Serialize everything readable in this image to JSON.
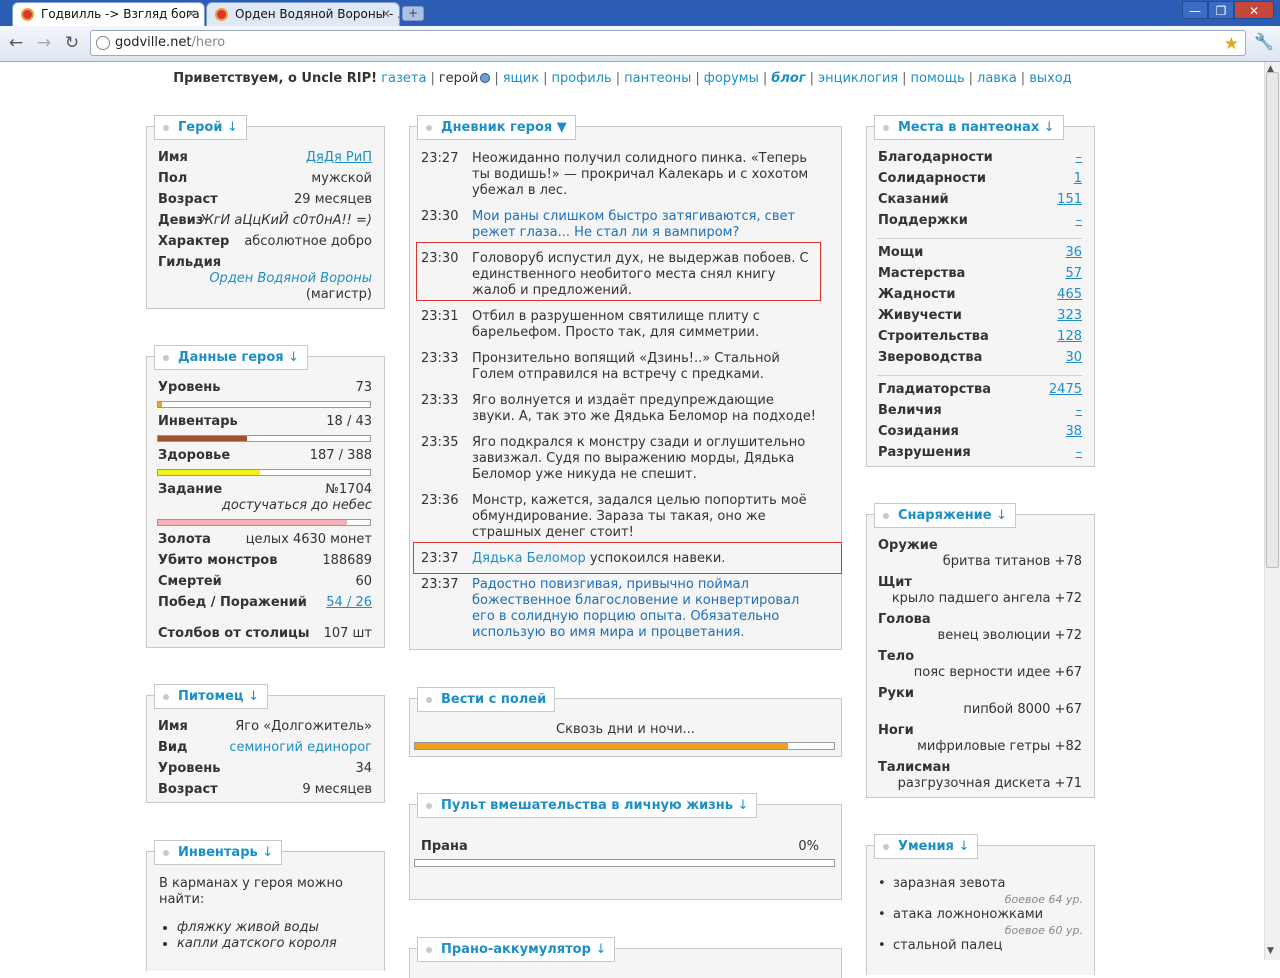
{
  "browser": {
    "tabs": [
      {
        "title": "Годвилль -> Взгляд бога"
      },
      {
        "title": "Орден Водяной Вороны - ..."
      }
    ],
    "url_domain": "godville.net",
    "url_path": "/hero",
    "window_buttons": {
      "minimize": "—",
      "maximize": "❐",
      "close": "✕"
    }
  },
  "topnav": {
    "greeting": "Приветствуем, о Uncle RIP!",
    "links": [
      "газета",
      "герой",
      "ящик",
      "профиль",
      "пантеоны",
      "форумы",
      "блог",
      "энциклогия",
      "помощь",
      "лавка",
      "выход"
    ]
  },
  "hero": {
    "title": "Герой",
    "arrow": "↓",
    "name_label": "Имя",
    "name": "ДяДя РиП",
    "gender_label": "Пол",
    "gender": "мужской",
    "age_label": "Возраст",
    "age": "29 месяцев",
    "motto_label": "Девиз",
    "motto": "ЖгИ аЦцКиЙ с0т0нА!! =)",
    "character_label": "Характер",
    "character": "абсолютное добро",
    "guild_label": "Гильдия",
    "guild": "Орден Водяной Вороны",
    "guild_rank": "(магистр)"
  },
  "stats": {
    "title": "Данные героя",
    "arrow": "↓",
    "level_label": "Уровень",
    "level": "73",
    "level_progress": 0.02,
    "inventory_label": "Инвентарь",
    "inventory": "18 / 43",
    "inventory_progress": 0.42,
    "health_label": "Здоровье",
    "health": "187 / 388",
    "health_progress": 0.48,
    "quest_label": "Задание",
    "quest_no": "№1704",
    "quest": "достучаться до небес",
    "quest_progress": 0.89,
    "gold_label": "Золота",
    "gold": "целых 4630 монет",
    "kills_label": "Убито монстров",
    "kills": "188689",
    "deaths_label": "Смертей",
    "deaths": "60",
    "wins_label": "Побед / Поражений",
    "wins": "54 / 26",
    "milestones_label": "Столбов от столицы",
    "milestones": "107 шт",
    "colors": {
      "level": "#f0a020",
      "inventory": "#a0522d",
      "health": "#f2f21a",
      "quest": "#f5b3b8"
    }
  },
  "pet": {
    "title": "Питомец",
    "arrow": "↓",
    "name_label": "Имя",
    "name": "Яго «Долгожитель»",
    "type_label": "Вид",
    "type": "семиногий единорог",
    "level_label": "Уровень",
    "level": "34",
    "age_label": "Возраст",
    "age": "9 месяцев"
  },
  "inventory": {
    "title": "Инвентарь",
    "arrow": "↓",
    "intro": "В карманах у героя можно найти:",
    "items": [
      "фляжку живой воды",
      "капли датского короля"
    ]
  },
  "diary": {
    "title": "Дневник героя ▼",
    "entries": [
      {
        "time": "23:27",
        "text": "Неожиданно получил солидного пинка. «Теперь ты водишь!» — прокричал Калекарь и с хохотом убежал в лес."
      },
      {
        "time": "23:30",
        "text": "Мои раны слишком быстро затягиваются, свет режет глаза... Не стал ли я вампиром?"
      },
      {
        "time": "23:30",
        "text": "Головоруб испустил дух, не выдержав побоев. С единственного необитого места снял книгу жалоб и предложений."
      },
      {
        "time": "23:31",
        "text": "Отбил в разрушенном святилище плиту с барельефом. Просто так, для симметрии."
      },
      {
        "time": "23:33",
        "text": "Пронзительно вопящий «Дзинь!..» Стальной Голем отправился на встречу с предками."
      },
      {
        "time": "23:33",
        "text": "Яго волнуется и издаёт предупреждающие звуки. А, так это же Дядька Беломор на подходе!"
      },
      {
        "time": "23:35",
        "text": "Яго подкрался к монстру сзади и оглушительно завизжал. Судя по выражению морды, Дядька Беломор уже никуда не спешит."
      },
      {
        "time": "23:36",
        "text": "Монстр, кажется, задался целью попортить моё обмундирование. Зараза ты такая, оно же страшных денег стоит!"
      },
      {
        "time": "23:37",
        "name": "Дядька Беломор",
        "text": "успокоился навеки."
      },
      {
        "time": "23:37",
        "text": "Радостно повизгивая, привычно поймал божественное благословение и конвертировал его в солидную порцию опыта. Обязательно использую во имя мира и процветания."
      }
    ]
  },
  "news": {
    "title": "Вести с полей",
    "text": "Сквозь дни и ночи...",
    "progress": 0.89
  },
  "remote": {
    "title": "Пульт вмешательства в личную жизнь",
    "arrow": "↓",
    "prana_label": "Прана",
    "prana": "0%"
  },
  "accumulator": {
    "title": "Прано-аккумулятор",
    "arrow": "↓"
  },
  "pantheons": {
    "title": "Места в пантеонах",
    "arrow": "↓",
    "items": [
      {
        "label": "Благодарности",
        "value": "–"
      },
      {
        "label": "Солидарности",
        "value": "1"
      },
      {
        "label": "Сказаний",
        "value": "151"
      },
      {
        "label": "Поддержки",
        "value": "–"
      },
      {
        "label": "Мощи",
        "value": "36"
      },
      {
        "label": "Мастерства",
        "value": "57"
      },
      {
        "label": "Жадности",
        "value": "465"
      },
      {
        "label": "Живучести",
        "value": "323"
      },
      {
        "label": "Строительства",
        "value": "128"
      },
      {
        "label": "Звероводства",
        "value": "30"
      },
      {
        "label": "Гладиаторства",
        "value": "2475"
      },
      {
        "label": "Величия",
        "value": "–"
      },
      {
        "label": "Созидания",
        "value": "38"
      },
      {
        "label": "Разрушения",
        "value": "–"
      }
    ]
  },
  "equipment": {
    "title": "Снаряжение",
    "arrow": "↓",
    "items": [
      {
        "slot": "Оружие",
        "item": "бритва титанов +78"
      },
      {
        "slot": "Щит",
        "item": "крыло падшего ангела +72"
      },
      {
        "slot": "Голова",
        "item": "венец эволюции +72"
      },
      {
        "slot": "Тело",
        "item": "пояс верности идее +67"
      },
      {
        "slot": "Руки",
        "item": "пипбой 8000 +67"
      },
      {
        "slot": "Ноги",
        "item": "мифриловые гетры +82"
      },
      {
        "slot": "Талисман",
        "item": "разгрузочная дискета +71"
      }
    ]
  },
  "skills": {
    "title": "Умения",
    "arrow": "↓",
    "items": [
      {
        "name": "заразная зевота",
        "level": "боевое 64 ур."
      },
      {
        "name": "атака ложноножками",
        "level": "боевое 60 ур."
      },
      {
        "name": "стальной палец",
        "level": ""
      }
    ]
  }
}
